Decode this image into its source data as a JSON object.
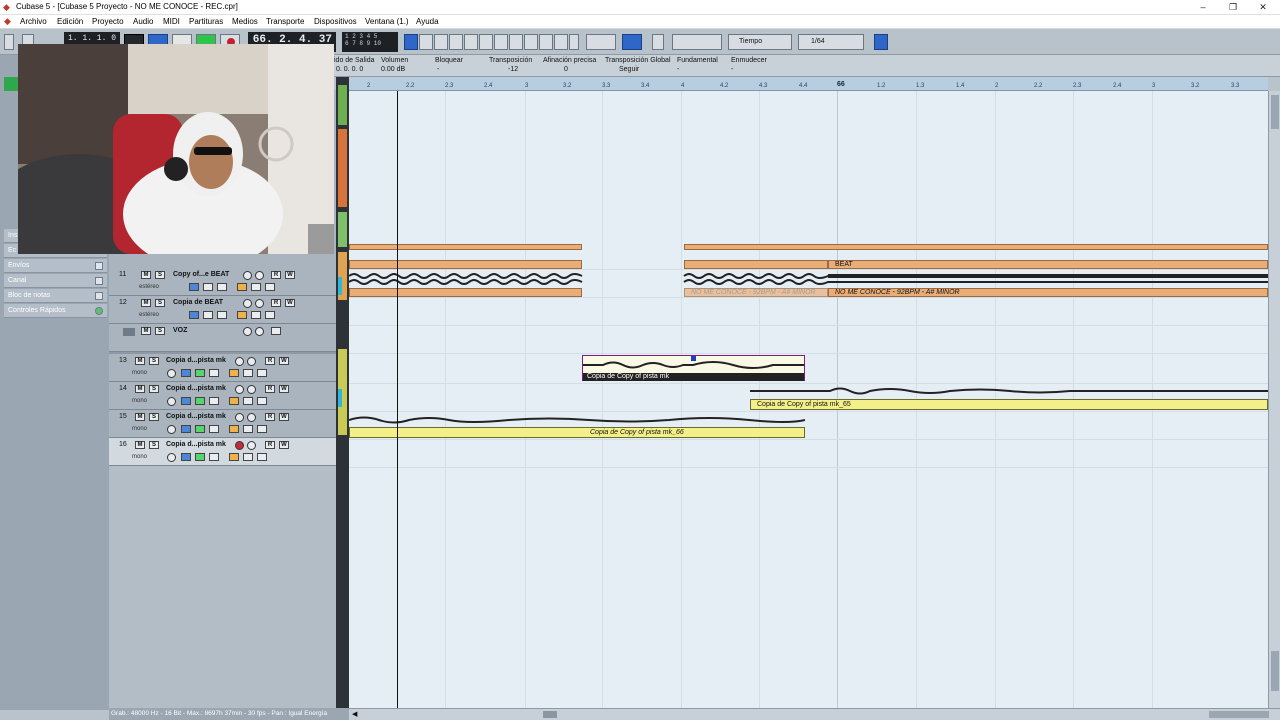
{
  "window": {
    "title": "Cubase 5 - [Cubase 5 Proyecto - NO ME CONOCE - REC.cpr]"
  },
  "menu": [
    "Archivo",
    "Edición",
    "Proyecto",
    "Audio",
    "MIDI",
    "Partituras",
    "Medios",
    "Transporte",
    "Dispositivos",
    "Ventana (1.)",
    "Ayuda"
  ],
  "transport": {
    "left_locator": "1. 1. 1.   0",
    "position": "66. 2. 4. 37",
    "quantize": "Tiempo",
    "grid_value": "1/64"
  },
  "infoline": {
    "labels": [
      "ido de Salida",
      "Volumen",
      "Bloquear",
      "Transposición",
      "Afinación precisa",
      "Transposición Global",
      "Fundamental",
      "Enmudecer"
    ],
    "values": [
      "0. 0. 0.   0",
      "0.00 dB",
      "-",
      "-12",
      "0",
      "Seguir",
      "-",
      "-"
    ]
  },
  "inspector": {
    "rows": [
      "Envíos",
      "Canal",
      "Bloc de notas",
      "Controles Rápidos"
    ],
    "partial_rows": [
      "Ins",
      "Ec"
    ]
  },
  "tracks": [
    {
      "num": "11",
      "name": "Copy of...e BEAT",
      "sub": "estéreo"
    },
    {
      "num": "12",
      "name": "Copia de BEAT",
      "sub": "estéreo"
    },
    {
      "num": "",
      "name": "VOZ",
      "sub": ""
    },
    {
      "num": "13",
      "name": "Copia d...pista mk",
      "sub": "mono"
    },
    {
      "num": "14",
      "name": "Copia d...pista mk",
      "sub": "mono"
    },
    {
      "num": "15",
      "name": "Copia d...pista mk",
      "sub": "mono"
    },
    {
      "num": "16",
      "name": "Copia d...pista mk",
      "sub": "mono"
    }
  ],
  "ruler": {
    "ticks": [
      "2",
      "2.2",
      "2.3",
      "2.4",
      "3",
      "3.2",
      "3.3",
      "3.4",
      "4",
      "4.2",
      "4.3",
      "4.4",
      "66",
      "1.2",
      "1.3",
      "1.4",
      "2",
      "2.2",
      "2.3",
      "2.4",
      "3",
      "3.2",
      "3.3"
    ]
  },
  "events": {
    "beat_label": "BEAT",
    "beat_sub_label": "NO ME CONOCE - 92BPM - A# MINOR",
    "beat_sub_label_faded": "NO ME CONOCE - 92BPM - A# MINOR",
    "event_13": "Copia de Copy of pista mk",
    "event_14": "Copia de Copy of pista mk_65",
    "event_15": "Copia de Copy of pista mk_66"
  },
  "status": {
    "text": "Grab.: 48000 Hz - 16 Bit - Max.: 8697h 37min - 30 fps - Pan : Igual Energía"
  },
  "colors": {
    "beat": "#e9ad78",
    "audio_event": "#f3f08a",
    "project_bg": "#e6eef5",
    "toolbar": "#b8c2cb"
  }
}
